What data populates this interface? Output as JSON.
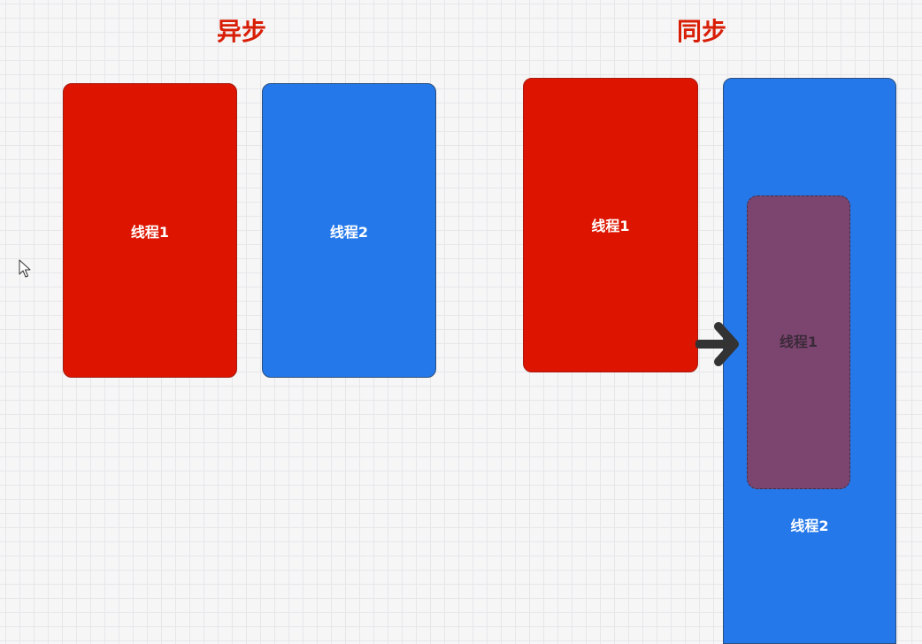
{
  "async": {
    "title": "异步",
    "thread1_label": "线程1",
    "thread2_label": "线程2"
  },
  "sync": {
    "title": "同步",
    "thread1_label": "线程1",
    "thread2_label": "线程2",
    "embedded_thread1_label": "线程1"
  },
  "colors": {
    "title": "#d81e06",
    "thread1": "#dd1500",
    "thread2": "#2478e9",
    "embedded": "#7c456f",
    "arrow": "#333333"
  },
  "icons": {
    "arrow": "right-arrow-icon",
    "cursor": "mouse-pointer-icon"
  }
}
